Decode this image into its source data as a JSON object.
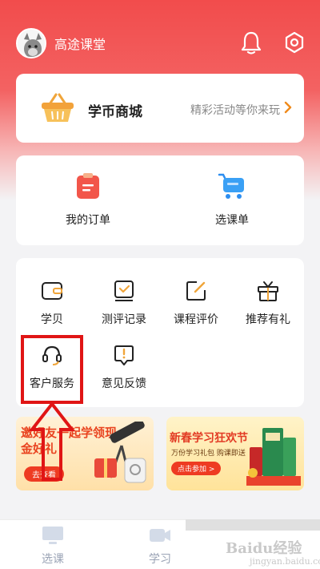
{
  "header": {
    "username": "高途课堂",
    "bell_icon": "bell-icon",
    "settings_icon": "hexagon-gear-icon"
  },
  "mall": {
    "title": "学币商城",
    "subtitle": "精彩活动等你来玩",
    "icon": "shopping-basket-icon"
  },
  "orders": [
    {
      "label": "我的订单",
      "icon": "clipboard-order-icon"
    },
    {
      "label": "选课单",
      "icon": "shopping-cart-icon"
    }
  ],
  "tools": [
    {
      "label": "学贝",
      "icon": "wallet-icon"
    },
    {
      "label": "测评记录",
      "icon": "test-record-icon"
    },
    {
      "label": "课程评价",
      "icon": "edit-review-icon"
    },
    {
      "label": "推荐有礼",
      "icon": "gift-icon"
    },
    {
      "label": "客户服务",
      "icon": "headset-icon"
    },
    {
      "label": "意见反馈",
      "icon": "feedback-icon"
    }
  ],
  "banners": {
    "left": {
      "title": "邀好友一起学领现金好礼",
      "button": "去查看"
    },
    "right": {
      "title": "新春学习狂欢节",
      "subtitle": "万份学习礼包 购课即送",
      "button": "点击参加 >"
    }
  },
  "bottom_nav": [
    {
      "label": "选课",
      "icon": "monitor-icon"
    },
    {
      "label": "学习",
      "icon": "video-camera-icon"
    }
  ],
  "watermark": {
    "brand": "Baidu经验",
    "url": "jingyan.baidu.com"
  },
  "colors": {
    "brand_red": "#f24c4c",
    "highlight_red": "#e01515",
    "accent_orange": "#f7a23b"
  }
}
